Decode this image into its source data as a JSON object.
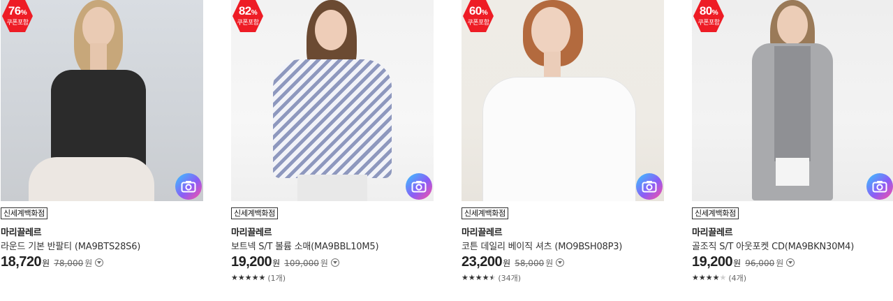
{
  "colors": {
    "badge_red": "#ee1c25",
    "camera_gradient": [
      "#35c7ff",
      "#8b5cf6",
      "#ff4fa0"
    ],
    "star_on": "#333333",
    "star_off": "#cfcfcf"
  },
  "products": [
    {
      "badge": {
        "percent": "76",
        "percent_sign": "%",
        "note": "쿠폰포함"
      },
      "store": "신세계백화점",
      "brand": "마리끌레르",
      "name": "라운드 기본 반팔티 (MA9BTS28S6)",
      "price": "18,720",
      "price_unit": "원",
      "original_price": "78,000",
      "original_unit": "원",
      "rating": null,
      "review_count": ""
    },
    {
      "badge": {
        "percent": "82",
        "percent_sign": "%",
        "note": "쿠폰포함"
      },
      "store": "신세계백화점",
      "brand": "마리끌레르",
      "name": "보트넥 S/T 볼륨 소매(MA9BBL10M5)",
      "price": "19,200",
      "price_unit": "원",
      "original_price": "109,000",
      "original_unit": "원",
      "rating": 5,
      "review_count": "(1개)"
    },
    {
      "badge": {
        "percent": "60",
        "percent_sign": "%",
        "note": "쿠폰포함"
      },
      "store": "신세계백화점",
      "brand": "마리끌레르",
      "name": "코튼 데일리 베이직 셔츠 (MO9BSH08P3)",
      "price": "23,200",
      "price_unit": "원",
      "original_price": "58,000",
      "original_unit": "원",
      "rating": 4.5,
      "review_count": "(34개)"
    },
    {
      "badge": {
        "percent": "80",
        "percent_sign": "%",
        "note": "쿠폰포함"
      },
      "store": "신세계백화점",
      "brand": "마리끌레르",
      "name": "골조직 S/T 아웃포켓 CD(MA9BKN30M4)",
      "price": "19,200",
      "price_unit": "원",
      "original_price": "96,000",
      "original_unit": "원",
      "rating": 4,
      "review_count": "(4개)"
    }
  ]
}
